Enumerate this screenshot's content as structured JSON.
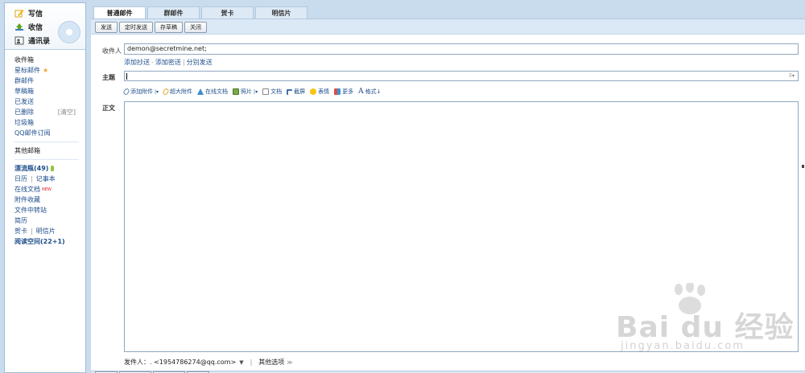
{
  "sidebar": {
    "quick": [
      {
        "label": "写信",
        "icon": "compose-icon"
      },
      {
        "label": "收信",
        "icon": "inbox-icon"
      },
      {
        "label": "通讯录",
        "icon": "contacts-icon"
      }
    ],
    "folders": {
      "inbox": "收件箱",
      "starred": "星标邮件",
      "group": "群邮件",
      "drafts": "草稿箱",
      "sent": "已发送",
      "deleted": "已删除",
      "deleted_action": "[清空]",
      "spam": "垃圾箱",
      "subscriptions": "QQ邮件订阅"
    },
    "other_mailbox": "其他邮箱",
    "apps": {
      "drift_bottle": "漂流瓶(49)",
      "calendar": "日历",
      "notes": "记事本",
      "online_docs": "在线文档",
      "new_badge": "NEW",
      "attachments": "附件收藏",
      "file_transfer": "文件中转站",
      "resume": "简历",
      "greeting_card": "贺卡",
      "postcard": "明信片",
      "reading_space": "阅读空间(22+1)"
    }
  },
  "tabs": [
    {
      "label": "普通邮件",
      "active": true
    },
    {
      "label": "群邮件",
      "active": false
    },
    {
      "label": "贺卡",
      "active": false
    },
    {
      "label": "明信片",
      "active": false
    }
  ],
  "toolbar": {
    "send": "发送",
    "scheduled_send": "定时发送",
    "save_draft": "存草稿",
    "close": "关闭"
  },
  "form": {
    "to_label": "收件人",
    "to_value": "demon@secretmine.net;",
    "add_cc": "添加抄送",
    "add_bcc": "添加密送",
    "separate_send": "分别发送",
    "subject_label": "主题",
    "subject_value": "",
    "body_label": "正文"
  },
  "format_bar": {
    "add_attachment": "添加附件",
    "large_attachment": "超大附件",
    "online_doc": "在线文档",
    "photo": "照片",
    "document": "文档",
    "screenshot": "截屏",
    "emoticon": "表情",
    "more": "更多",
    "format": "格式"
  },
  "sender": {
    "label": "发件人：",
    "value": ". <1954786274@qq.com>",
    "more_options": "其他选项"
  },
  "watermark": {
    "text": "Bai du 经验",
    "url": "jingyan.baidu.com"
  },
  "colors": {
    "accent_link": "#1e4e8c",
    "panel_bg": "#c9dcee",
    "toolbar_bg": "#dbe8f5"
  }
}
